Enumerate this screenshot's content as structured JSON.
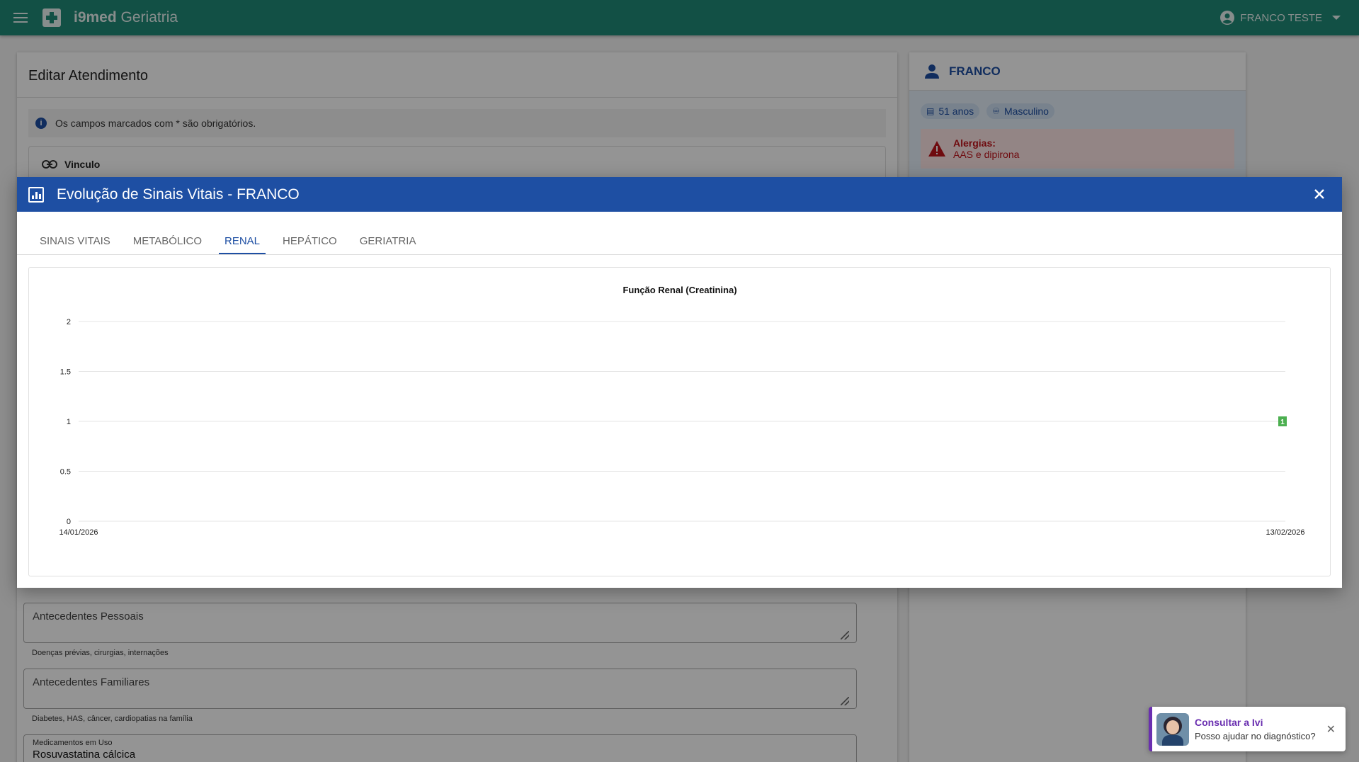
{
  "app": {
    "title_bold": "i9med",
    "title_rest": "Geriatria",
    "user_name": "FRANCO TESTE"
  },
  "main_form": {
    "title": "Editar Atendimento",
    "required_note": "Os campos marcados com * são obrigatórios.",
    "vinculo_label": "Vinculo",
    "antecedentes_pessoais": {
      "placeholder": "Antecedentes Pessoais",
      "hint": "Doenças prévias, cirurgias, internações"
    },
    "antecedentes_familiares": {
      "placeholder": "Antecedentes Familiares",
      "hint": "Diabetes, HAS, câncer, cardiopatias na família"
    },
    "medicamentos": {
      "label": "Medicamentos em Uso",
      "value": "Rosuvastatina cálcica"
    }
  },
  "patient": {
    "name": "FRANCO",
    "age": "51 anos",
    "sex": "Masculino",
    "allergy_label": "Alergias:",
    "allergy_value": "AAS e dipirona"
  },
  "dialog": {
    "title": "Evolução de Sinais Vitais - FRANCO",
    "tabs": [
      {
        "label": "SINAIS VITAIS",
        "active": false
      },
      {
        "label": "METABÓLICO",
        "active": false
      },
      {
        "label": "RENAL",
        "active": true
      },
      {
        "label": "HEPÁTICO",
        "active": false
      },
      {
        "label": "GERIATRIA",
        "active": false
      }
    ]
  },
  "chart_data": {
    "type": "line",
    "title": "Função Renal (Creatinina)",
    "x": [
      "14/01/2026",
      "13/02/2026"
    ],
    "ylim": [
      0,
      2
    ],
    "yticks": [
      "0",
      "0.5",
      "1",
      "1.5",
      "2"
    ],
    "series": [
      {
        "values": [
          1
        ],
        "x": [
          "13/02/2026"
        ],
        "data_labels": [
          "1"
        ],
        "color": "#4caf50"
      }
    ],
    "grid": true,
    "legend": "none"
  },
  "ivi": {
    "title": "Consultar a Ivi",
    "subtitle": "Posso ajudar no diagnóstico?"
  },
  "colors": {
    "appbar": "#1f8a78",
    "primary": "#1e4fa3",
    "ivi_accent": "#6a2fb0",
    "allergy": "#c0141b",
    "point": "#4caf50"
  }
}
